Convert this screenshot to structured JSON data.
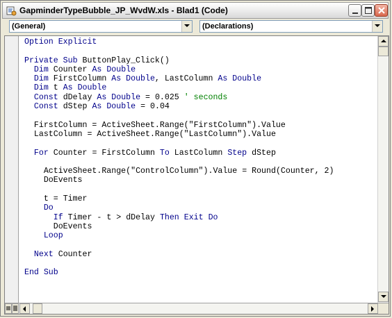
{
  "window": {
    "title": "GapminderTypeBubble_JP_WvdW.xls - Blad1 (Code)"
  },
  "combos": {
    "object": "(General)",
    "procedure": "(Declarations)"
  },
  "code_lines": [
    "Option Explicit",
    "",
    "Private Sub ButtonPlay_Click()",
    "  Dim Counter As Double",
    "  Dim FirstColumn As Double, LastColumn As Double",
    "  Dim t As Double",
    "  Const dDelay As Double = 0.025 ' seconds",
    "  Const dStep As Double = 0.04",
    "",
    "  FirstColumn = ActiveSheet.Range(\"FirstColumn\").Value",
    "  LastColumn = ActiveSheet.Range(\"LastColumn\").Value",
    "",
    "  For Counter = FirstColumn To LastColumn Step dStep",
    "",
    "    ActiveSheet.Range(\"ControlColumn\").Value = Round(Counter, 2)",
    "    DoEvents",
    "",
    "    t = Timer",
    "    Do",
    "      If Timer - t > dDelay Then Exit Do",
    "      DoEvents",
    "    Loop",
    "",
    "  Next Counter",
    "",
    "End Sub"
  ],
  "colors": {
    "keyword": "#00008B",
    "comment": "#008000",
    "text": "#000000"
  },
  "icons": {
    "app": "vba-code-icon",
    "minimize": "minimize-icon",
    "maximize": "maximize-icon",
    "close": "close-icon"
  }
}
